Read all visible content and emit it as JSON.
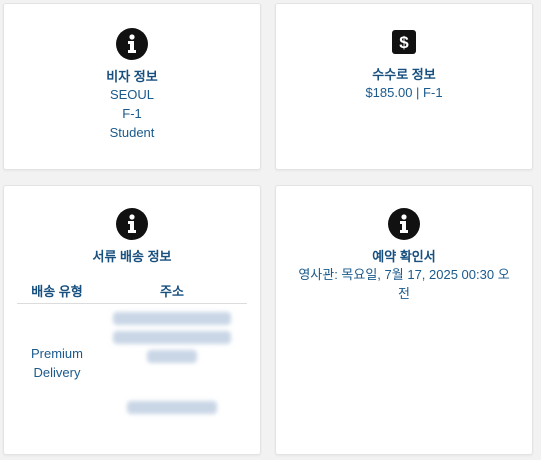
{
  "visa": {
    "icon": "info-circle-icon",
    "title": "비자 정보",
    "lines": [
      "SEOUL",
      "F-1",
      "Student"
    ]
  },
  "fee": {
    "icon": "dollar-sign-icon",
    "title": "수수로 정보",
    "text": "$185.00 | F-1"
  },
  "delivery": {
    "icon": "info-circle-icon",
    "title": "서류 배송 정보",
    "headers": {
      "type": "배송 유형",
      "address": "주소"
    },
    "type_value": "Premium Delivery"
  },
  "appointment": {
    "icon": "info-circle-icon",
    "title": "예약 확인서",
    "text": "영사관: 목요일, 7월 17, 2025 00:30 오전"
  },
  "colors": {
    "accent": "#1a5a8c",
    "background": "#f2f2f2",
    "icon": "#111111"
  }
}
